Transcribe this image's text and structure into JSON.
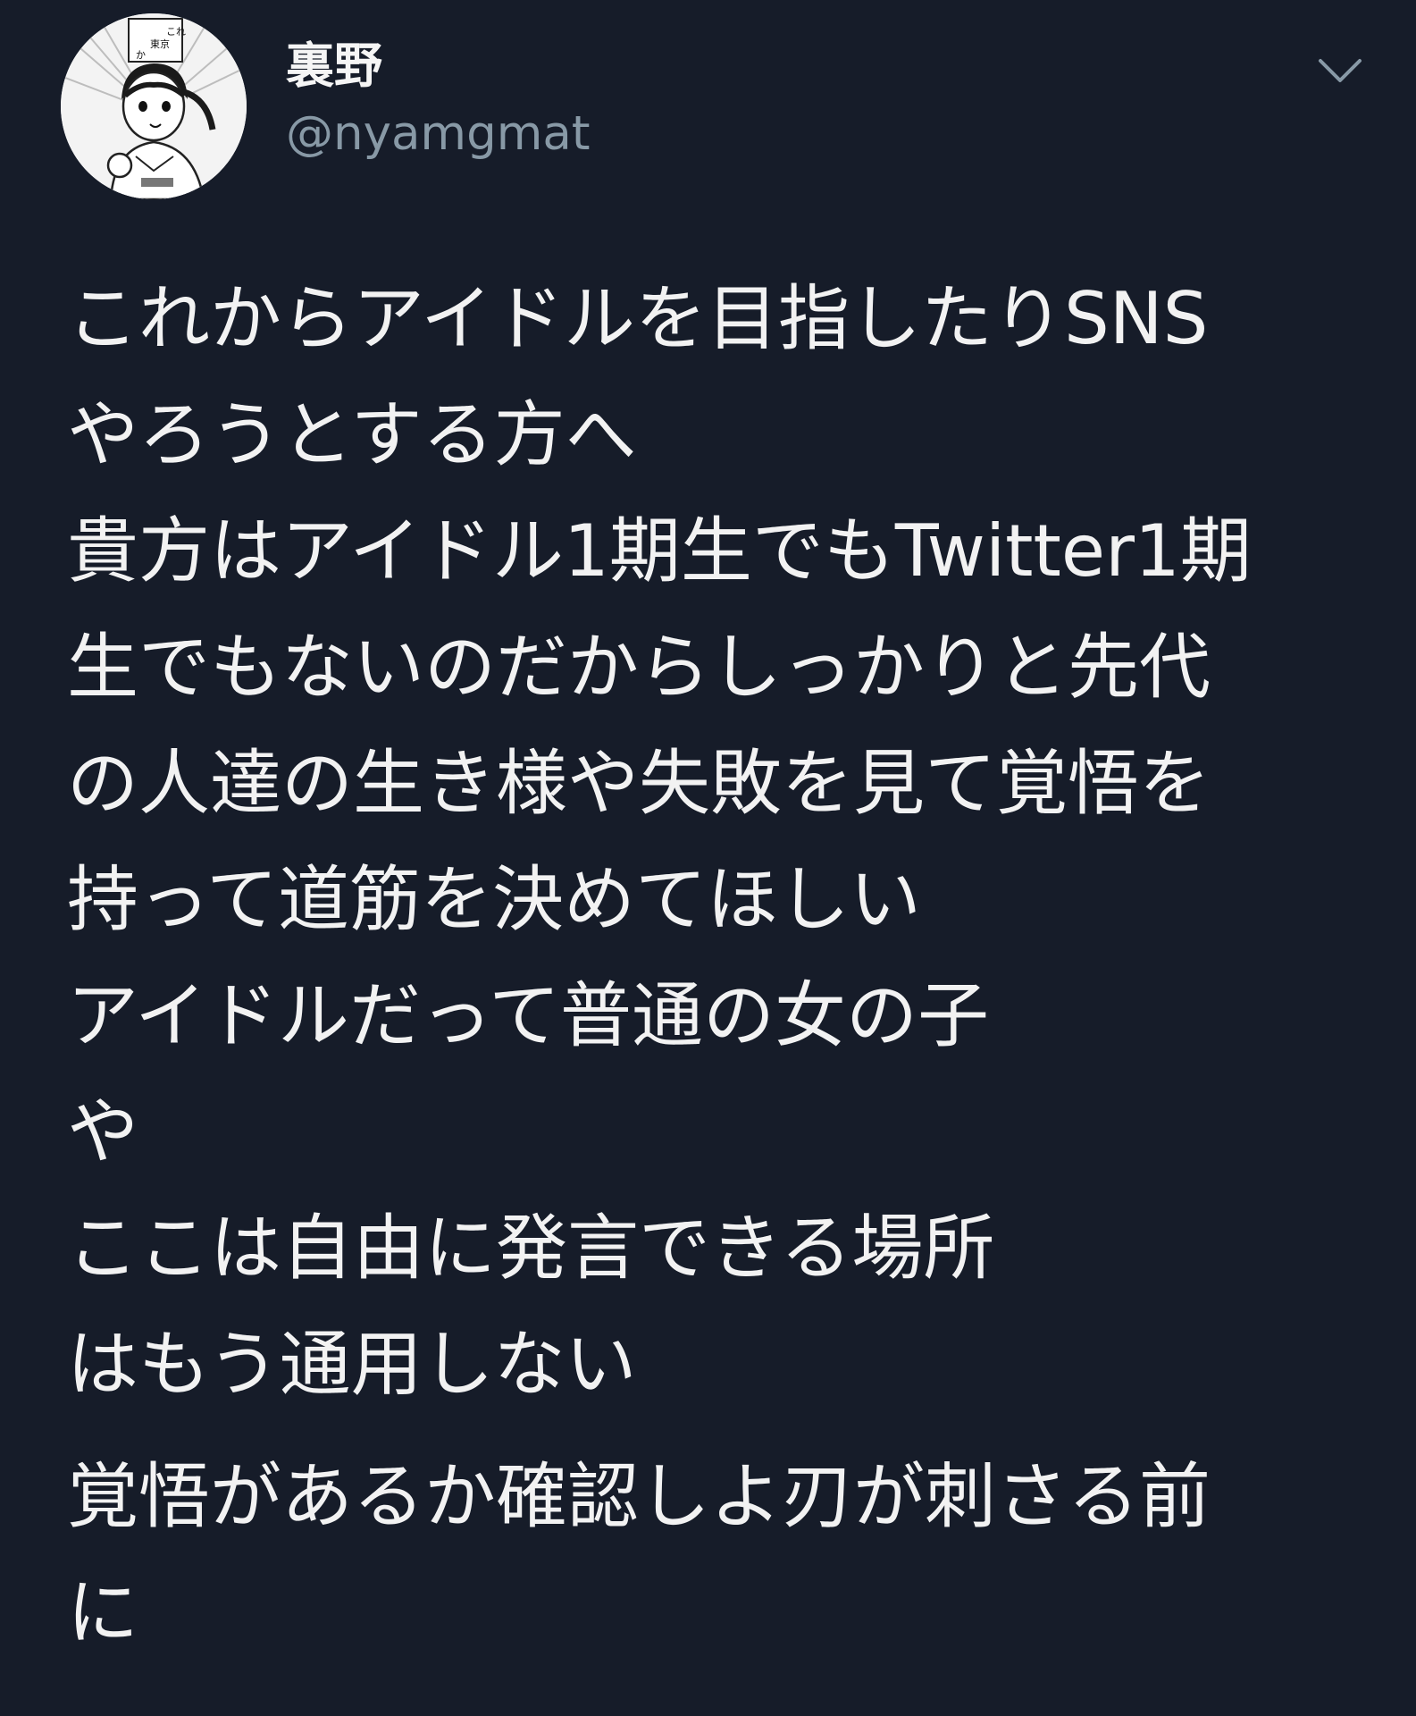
{
  "colors": {
    "background": "#161c29",
    "text": "#f2f2f2",
    "handle": "#8899a6"
  },
  "user": {
    "display_name": "裏野",
    "handle": "@nyamgmat",
    "avatar_caption": "これが東京か"
  },
  "icons": {
    "caret": "chevron-down-icon"
  },
  "tweet": {
    "lines": [
      "これからアイドルを目指したりSNS",
      "やろうとする方へ",
      "貴方はアイドル1期生でもTwitter1期",
      "生でもないのだからしっかりと先代",
      "の人達の生き様や失敗を見て覚悟を",
      "持って道筋を決めてほしい",
      "アイドルだって普通の女の子",
      "や",
      "ここは自由に発言できる場所",
      "はもう通用しない",
      "覚悟があるか確認しよ刃が刺さる前",
      "に"
    ]
  }
}
